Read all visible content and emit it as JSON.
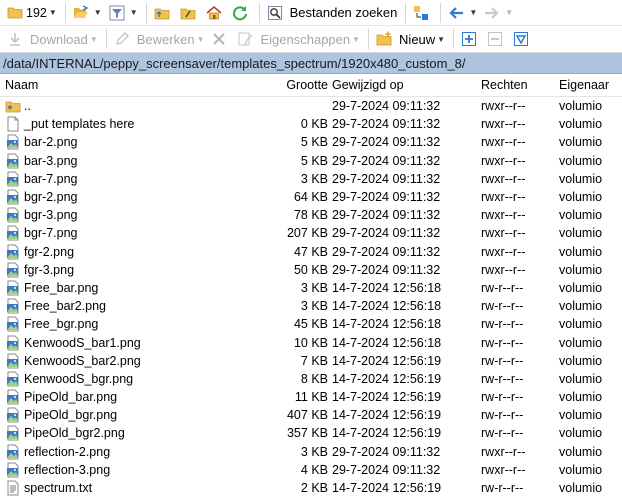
{
  "toolbar1": {
    "folder_label": "192",
    "search_label": "Bestanden zoeken"
  },
  "toolbar2": {
    "download_label": "Download",
    "edit_label": "Bewerken",
    "properties_label": "Eigenschappen",
    "new_label": "Nieuw"
  },
  "path": "/data/INTERNAL/peppy_screensaver/templates_spectrum/1920x480_custom_8/",
  "columns": {
    "name": "Naam",
    "size": "Grootte",
    "modified": "Gewijzigd op",
    "rights": "Rechten",
    "owner": "Eigenaar"
  },
  "files": [
    {
      "name": "..",
      "size": "",
      "modified": "29-7-2024 09:11:32",
      "rights": "rwxr--r--",
      "owner": "volumio",
      "icon": "parent-folder-icon"
    },
    {
      "name": "_put templates here",
      "size": "0 KB",
      "modified": "29-7-2024 09:11:32",
      "rights": "rwxr--r--",
      "owner": "volumio",
      "icon": "blank-file-icon"
    },
    {
      "name": "bar-2.png",
      "size": "5 KB",
      "modified": "29-7-2024 09:11:32",
      "rights": "rwxr--r--",
      "owner": "volumio",
      "icon": "image-file-icon"
    },
    {
      "name": "bar-3.png",
      "size": "5 KB",
      "modified": "29-7-2024 09:11:32",
      "rights": "rwxr--r--",
      "owner": "volumio",
      "icon": "image-file-icon"
    },
    {
      "name": "bar-7.png",
      "size": "3 KB",
      "modified": "29-7-2024 09:11:32",
      "rights": "rwxr--r--",
      "owner": "volumio",
      "icon": "image-file-icon"
    },
    {
      "name": "bgr-2.png",
      "size": "64 KB",
      "modified": "29-7-2024 09:11:32",
      "rights": "rwxr--r--",
      "owner": "volumio",
      "icon": "image-file-icon"
    },
    {
      "name": "bgr-3.png",
      "size": "78 KB",
      "modified": "29-7-2024 09:11:32",
      "rights": "rwxr--r--",
      "owner": "volumio",
      "icon": "image-file-icon"
    },
    {
      "name": "bgr-7.png",
      "size": "207 KB",
      "modified": "29-7-2024 09:11:32",
      "rights": "rwxr--r--",
      "owner": "volumio",
      "icon": "image-file-icon"
    },
    {
      "name": "fgr-2.png",
      "size": "47 KB",
      "modified": "29-7-2024 09:11:32",
      "rights": "rwxr--r--",
      "owner": "volumio",
      "icon": "image-file-icon"
    },
    {
      "name": "fgr-3.png",
      "size": "50 KB",
      "modified": "29-7-2024 09:11:32",
      "rights": "rwxr--r--",
      "owner": "volumio",
      "icon": "image-file-icon"
    },
    {
      "name": "Free_bar.png",
      "size": "3 KB",
      "modified": "14-7-2024 12:56:18",
      "rights": "rw-r--r--",
      "owner": "volumio",
      "icon": "image-file-icon"
    },
    {
      "name": "Free_bar2.png",
      "size": "3 KB",
      "modified": "14-7-2024 12:56:18",
      "rights": "rw-r--r--",
      "owner": "volumio",
      "icon": "image-file-icon"
    },
    {
      "name": "Free_bgr.png",
      "size": "45 KB",
      "modified": "14-7-2024 12:56:18",
      "rights": "rw-r--r--",
      "owner": "volumio",
      "icon": "image-file-icon"
    },
    {
      "name": "KenwoodS_bar1.png",
      "size": "10 KB",
      "modified": "14-7-2024 12:56:18",
      "rights": "rw-r--r--",
      "owner": "volumio",
      "icon": "image-file-icon"
    },
    {
      "name": "KenwoodS_bar2.png",
      "size": "7 KB",
      "modified": "14-7-2024 12:56:19",
      "rights": "rw-r--r--",
      "owner": "volumio",
      "icon": "image-file-icon"
    },
    {
      "name": "KenwoodS_bgr.png",
      "size": "8 KB",
      "modified": "14-7-2024 12:56:19",
      "rights": "rw-r--r--",
      "owner": "volumio",
      "icon": "image-file-icon"
    },
    {
      "name": "PipeOld_bar.png",
      "size": "11 KB",
      "modified": "14-7-2024 12:56:19",
      "rights": "rw-r--r--",
      "owner": "volumio",
      "icon": "image-file-icon"
    },
    {
      "name": "PipeOld_bgr.png",
      "size": "407 KB",
      "modified": "14-7-2024 12:56:19",
      "rights": "rw-r--r--",
      "owner": "volumio",
      "icon": "image-file-icon"
    },
    {
      "name": "PipeOld_bgr2.png",
      "size": "357 KB",
      "modified": "14-7-2024 12:56:19",
      "rights": "rw-r--r--",
      "owner": "volumio",
      "icon": "image-file-icon"
    },
    {
      "name": "reflection-2.png",
      "size": "3 KB",
      "modified": "29-7-2024 09:11:32",
      "rights": "rwxr--r--",
      "owner": "volumio",
      "icon": "image-file-icon"
    },
    {
      "name": "reflection-3.png",
      "size": "4 KB",
      "modified": "29-7-2024 09:11:32",
      "rights": "rwxr--r--",
      "owner": "volumio",
      "icon": "image-file-icon"
    },
    {
      "name": "spectrum.txt",
      "size": "2 KB",
      "modified": "14-7-2024 12:56:19",
      "rights": "rw-r--r--",
      "owner": "volumio",
      "icon": "text-file-icon"
    }
  ],
  "colors": {
    "path_bar": "#aec4df",
    "folder": "#f2c14e",
    "accent_blue": "#2b7bd6",
    "refresh_green": "#2fa84f"
  }
}
